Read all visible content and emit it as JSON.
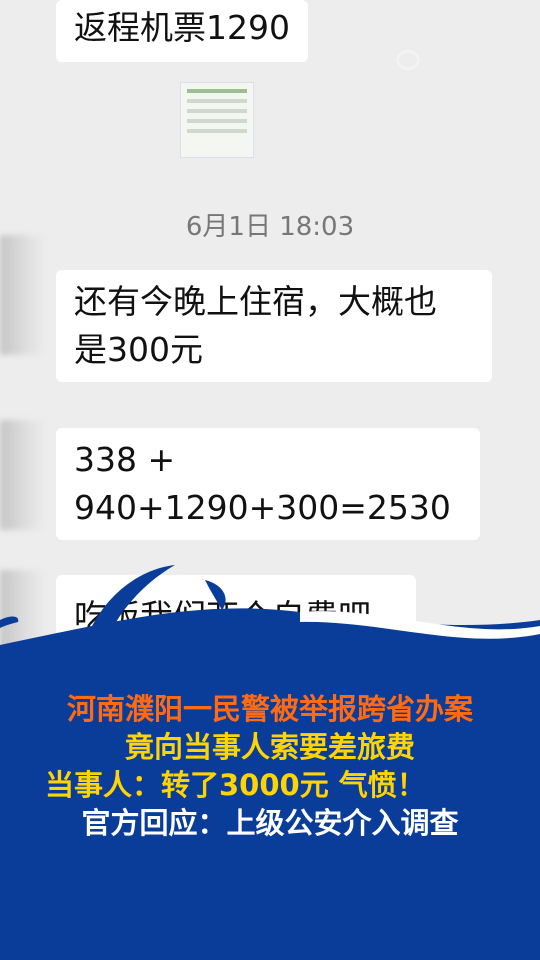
{
  "chat": {
    "messages": [
      {
        "text": "返程机票1290"
      },
      {
        "text": "还有今晚上住宿，大概也\n是300元"
      },
      {
        "text": "338 +\n940+1290+300=2530"
      },
      {
        "text": "吃饭我们两个自费吧"
      }
    ],
    "timestamp": "6月1日 18:03",
    "image_attachment": "ticket-screenshot-thumbnail"
  },
  "overlay": {
    "lines": [
      {
        "text": "河南濮阳一民警被举报跨省办案",
        "color": "#ff6a13"
      },
      {
        "text": "竟向当事人索要差旅费",
        "color": "#ffd400"
      },
      {
        "text": "当事人：转了3000元 气愤！",
        "color": "#ffd400"
      },
      {
        "text": "官方回应：上级公安介入调查",
        "color": "#ffffff"
      }
    ],
    "background_color": "#0a3c9a"
  }
}
